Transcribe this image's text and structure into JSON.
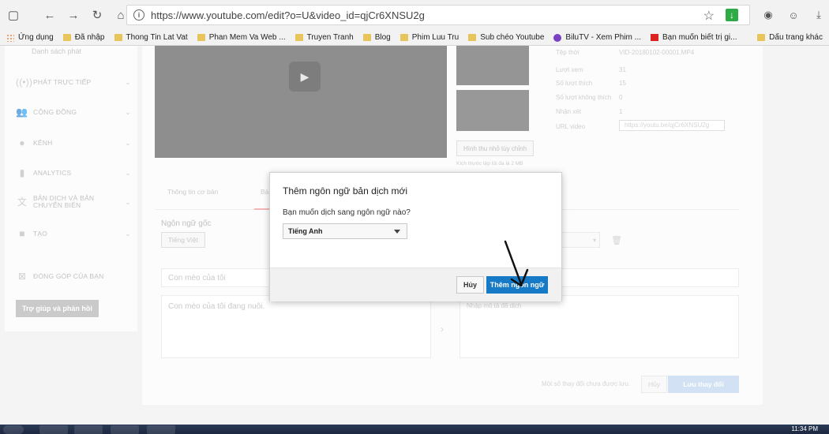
{
  "browser": {
    "url": "https://www.youtube.com/edit?o=U&video_id=qjCr6XNSU2g",
    "bookmarks": [
      {
        "label": "Ứng dụng",
        "icon": "apps-grid-icon"
      },
      {
        "label": "Đã nhập",
        "icon": "folder-icon"
      },
      {
        "label": "Thong Tin Lat Vat",
        "icon": "folder-icon"
      },
      {
        "label": "Phan Mem Va Web ...",
        "icon": "folder-icon"
      },
      {
        "label": "Truyen Tranh",
        "icon": "folder-icon"
      },
      {
        "label": "Blog",
        "icon": "folder-icon"
      },
      {
        "label": "Phim Luu Tru",
        "icon": "folder-icon"
      },
      {
        "label": "Sub chéo Youtube",
        "icon": "folder-icon"
      },
      {
        "label": "BiluTV - Xem Phim ...",
        "icon": "site-icon"
      },
      {
        "label": "Bạn muốn biết trị gi...",
        "icon": "site-icon"
      }
    ],
    "bookmarks_right": "Dấu trang khác"
  },
  "sidebar": {
    "sub_label": "Danh sách phát",
    "items": [
      {
        "label": "PHÁT TRỰC TIẾP",
        "icon": "live-icon"
      },
      {
        "label": "CỘNG ĐỒNG",
        "icon": "community-icon"
      },
      {
        "label": "KÊNH",
        "icon": "channel-icon"
      },
      {
        "label": "ANALYTICS",
        "icon": "analytics-icon"
      },
      {
        "label": "BẢN DỊCH VÀ BẢN CHUYỂN BIÊN",
        "icon": "translate-icon"
      },
      {
        "label": "TẠO",
        "icon": "create-icon"
      },
      {
        "label": "ĐÓNG GÓP CỦA BẠN",
        "icon": "contribution-icon"
      }
    ],
    "help_button": "Trợ giúp và phản hồi"
  },
  "video_meta": {
    "rows": [
      {
        "key": "Tệp thời",
        "value": "VID-20180102-00001.MP4"
      },
      {
        "key": "Lượt xem",
        "value": "31"
      },
      {
        "key": "Số lượt thích",
        "value": "15"
      },
      {
        "key": "Số lượt không thích",
        "value": "0"
      },
      {
        "key": "Nhận xét",
        "value": "1"
      },
      {
        "key": "URL video",
        "value": ""
      }
    ],
    "url_value": "https://youtu.be/qjCr6XNSU2g",
    "custom_thumb_button": "Hình thu nhỏ tùy chỉnh",
    "thumb_note": "Kích thước tệp tối đa là 2 MB"
  },
  "tabs": [
    "Thông tin cơ bản",
    "Bản dịch"
  ],
  "editor": {
    "original_language_label": "Ngôn ngữ gốc",
    "original_language_value": "Tiếng Việt",
    "title_value": "Con mèo của tôi",
    "description_value": "Con mèo của tôi đang nuôi.",
    "right_description_placeholder": "Nhập mô tả đã dịch",
    "footer_note": "Một số thay đổi chưa được lưu.",
    "cancel_label": "Hủy",
    "save_label": "Lưu thay đổi"
  },
  "modal": {
    "title": "Thêm ngôn ngữ bản dịch mới",
    "question": "Bạn muốn dịch sang ngôn ngữ nào?",
    "selected_language": "Tiếng Anh",
    "cancel_label": "Hủy",
    "add_label": "Thêm ngôn ngữ"
  },
  "taskbar": {
    "clock": "11:34 PM"
  },
  "colors": {
    "primary_button": "#167ac6",
    "tab_underline": "#e88888"
  }
}
